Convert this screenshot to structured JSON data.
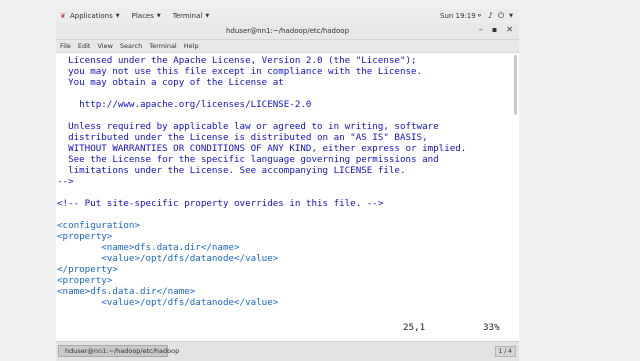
{
  "topbar": {
    "applications": "Applications",
    "places": "Places",
    "terminal": "Terminal",
    "clock": "Sun 19:19"
  },
  "window": {
    "title": "hduser@nn1:~/hadoop/etc/hadoop",
    "controls": {
      "minimize": "–",
      "maximize": "▪",
      "close": "✕"
    }
  },
  "menu": [
    "File",
    "Edit",
    "View",
    "Search",
    "Terminal",
    "Help"
  ],
  "editor": {
    "lines": [
      "  Licensed under the Apache License, Version 2.0 (the \"License\");",
      "  you may not use this file except in compliance with the License.",
      "  You may obtain a copy of the License at",
      "",
      "    http://www.apache.org/licenses/LICENSE-2.0",
      "",
      "  Unless required by applicable law or agreed to in writing, software",
      "  distributed under the License is distributed on an \"AS IS\" BASIS,",
      "  WITHOUT WARRANTIES OR CONDITIONS OF ANY KIND, either express or implied.",
      "  See the License for the specific language governing permissions and",
      "  limitations under the License. See accompanying LICENSE file.",
      "-->",
      "",
      "<!-- Put site-specific property overrides in this file. -->",
      "",
      "<configuration>",
      "<property>",
      "        <name>dfs.data.dir</name>",
      "        <value>/opt/dfs/datanode</value>",
      "</property>",
      "<property>",
      "<name>dfs.data.dir</name>",
      "        <value>/opt/dfs/datanode</value>"
    ],
    "status_pos": "25,1",
    "status_pct": "33%"
  },
  "taskbar": {
    "task_label": "hduser@nn1:~/hadoop/etc/hadoop",
    "pager": "1 / 4"
  }
}
